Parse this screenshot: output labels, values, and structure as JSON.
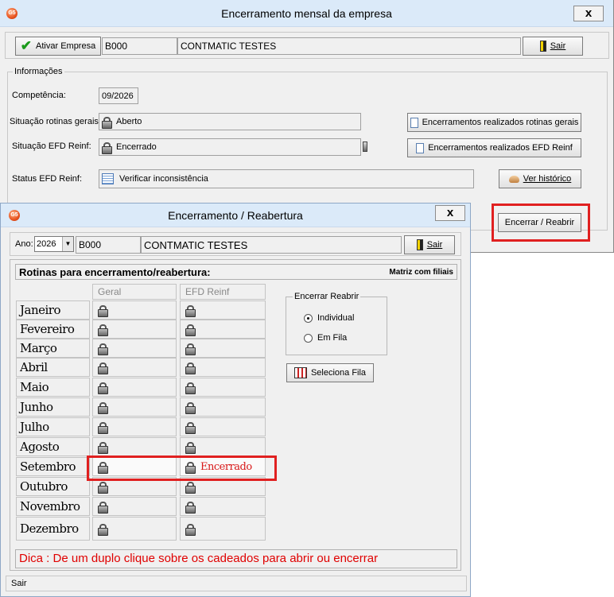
{
  "main_window": {
    "title": "Encerramento mensal da empresa",
    "close_label": "x",
    "toolbar": {
      "ativar_label": "Ativar Empresa",
      "company_code": "B000",
      "company_name": "CONTMATIC TESTES",
      "sair_label": "Sair"
    },
    "info": {
      "group_label": "Informações",
      "competencia_label": "Competência:",
      "competencia_value": "09/2026",
      "rotinas_label": "Situação rotinas gerais:",
      "rotinas_value": "Aberto",
      "efd_label": "Situação EFD Reinf:",
      "efd_value": "Encerrado",
      "status_label": "Status EFD Reinf:",
      "status_value": "Verificar inconsistência",
      "btn_rotinas": "Encerramentos realizados rotinas gerais",
      "btn_efd": "Encerramentos realizados EFD Reinf",
      "btn_historico": "Ver histórico",
      "btn_encerrar": "Encerrar / Reabrir"
    }
  },
  "dialog": {
    "title": "Encerramento / Reabertura",
    "close_label": "x",
    "ano_label": "Ano:",
    "ano_value": "2026",
    "company_code": "B000",
    "company_name": "CONTMATIC TESTES",
    "sair_label": "Sair",
    "header_title": "Rotinas para encerramento/reabertura:",
    "header_right": "Matriz com filiais",
    "col_geral": "Geral",
    "col_efd": "EFD Reinf",
    "months": [
      "Janeiro",
      "Fevereiro",
      "Março",
      "Abril",
      "Maio",
      "Junho",
      "Julho",
      "Agosto",
      "Setembro",
      "Outubro",
      "Novembro",
      "Dezembro"
    ],
    "setembro_efd_status": "Encerrado",
    "group_label": "Encerrar Reabrir",
    "radio_individual": "Individual",
    "radio_emfila": "Em Fila",
    "radio_selected": "Individual",
    "btn_seleciona": "Seleciona Fila",
    "dica": "Dica : De um duplo clique sobre os cadeados para  abrir ou encerrar",
    "status_bar": "Sair"
  },
  "colors": {
    "titlebar": "#dbeaf9",
    "highlight_red": "#e02020",
    "dica_text": "#e00000",
    "window_bg": "#f0f0f0"
  }
}
